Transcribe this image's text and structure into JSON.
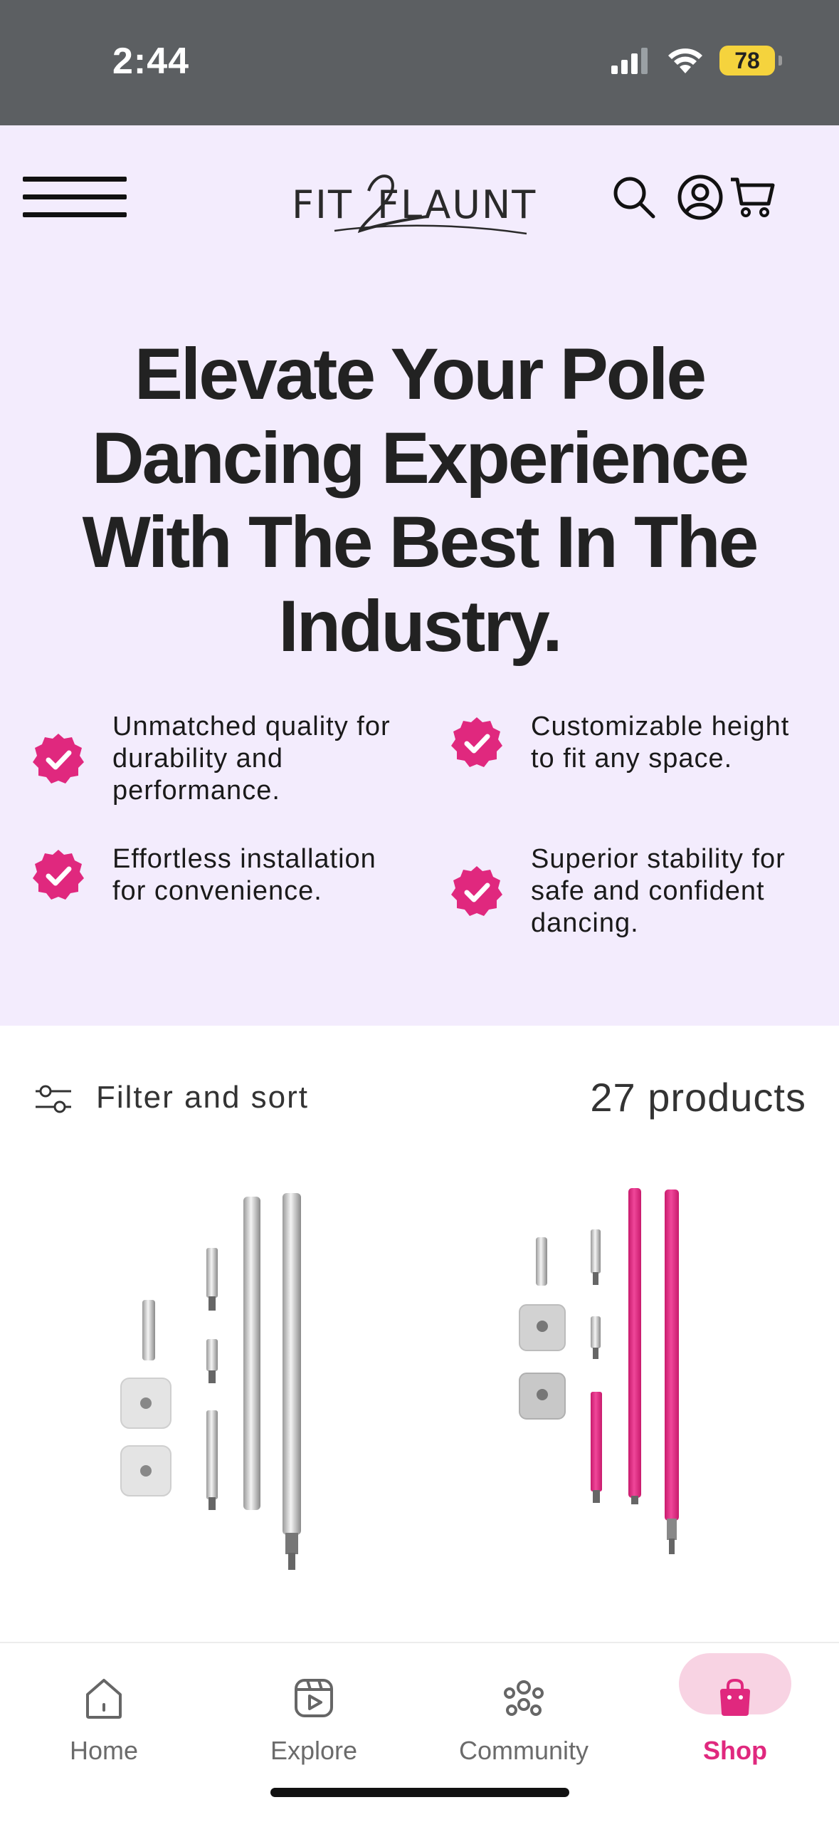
{
  "status_bar": {
    "time": "2:44",
    "battery": "78"
  },
  "header": {
    "logo_text": "FIT2FLAUNT"
  },
  "hero": {
    "title": "Elevate Your Pole Dancing Experience With The Best In The Industry.",
    "features": [
      "Unmatched quality for durability and performance.",
      "Customizable height to fit any space.",
      "Effortless installation for convenience.",
      "Superior stability for safe and confident dancing."
    ]
  },
  "filter": {
    "label": "Filter and sort",
    "count": "27 products"
  },
  "products": [
    {
      "name": "chrome-pole-kit",
      "pole_color": "#c9c9c9"
    },
    {
      "name": "pink-pole-kit",
      "pole_color": "#e0287e"
    }
  ],
  "bottom_nav": {
    "items": [
      {
        "label": "Home",
        "icon": "home-icon"
      },
      {
        "label": "Explore",
        "icon": "explore-icon"
      },
      {
        "label": "Community",
        "icon": "community-icon"
      },
      {
        "label": "Shop",
        "icon": "shop-bag-icon",
        "active": true
      }
    ]
  },
  "colors": {
    "accent": "#e0287e",
    "hero_bg": "#f3ecfd",
    "status_bg": "#5c5f62"
  }
}
